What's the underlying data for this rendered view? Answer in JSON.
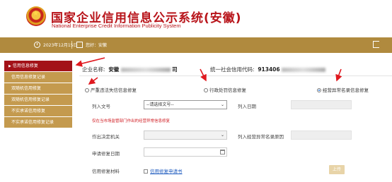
{
  "header": {
    "title": "国家企业信用信息公示系统(安徽)",
    "subtitle": "National Enterprise Credit Information Publicity System"
  },
  "infobar": {
    "date": "2023年12月15日",
    "user_prefix": "您好：",
    "user_name": "安徽"
  },
  "sidebar": {
    "items": [
      {
        "label": "信用信息修复",
        "active": true
      },
      {
        "label": "信用信息修复记录"
      },
      {
        "label": "双随机信用修复"
      },
      {
        "label": "双随机信用修复记录"
      },
      {
        "label": "不实承诺信用修复"
      },
      {
        "label": "不实承诺信用修复记录"
      }
    ]
  },
  "company": {
    "name_label": "企业名称:",
    "name_value": "安徽",
    "name_tail": "司",
    "credit_label": "统一社会信用代码:",
    "credit_value": "913406"
  },
  "repair_types": [
    {
      "label": "严重违法失信信息修复",
      "checked": false
    },
    {
      "label": "行政处罚信息修复",
      "checked": false
    },
    {
      "label": "经营异常名录信息修复",
      "checked": true
    }
  ],
  "form": {
    "doc_no_label": "列入文号",
    "doc_no_placeholder": "--请选择文号--",
    "list_date_label": "列入日期",
    "hint": "仅在当市场监管部门作出的经营异常信息修复",
    "decision_org_label": "作出决定机关",
    "reason_label": "列入经营异常名录原因",
    "apply_date_label": "申请修复日期",
    "material_label": "信用修复材料",
    "material_link": "信用修复申请书",
    "upload_label": "上传"
  },
  "colors": {
    "brand_red": "#b8141a",
    "gold": "#b08a3e",
    "sidebar_gold": "#c49a4e",
    "active_red": "#a31218",
    "annotation_red": "#e0191f"
  }
}
